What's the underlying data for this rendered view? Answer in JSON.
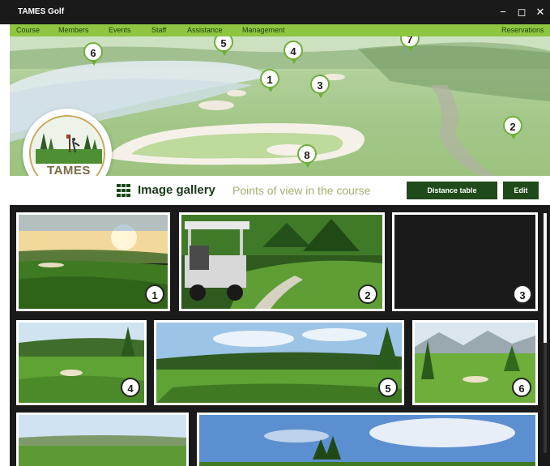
{
  "window": {
    "title": "TAMES Golf",
    "controls": {
      "minimize": "−",
      "maximize": "◻",
      "close": "✕"
    }
  },
  "menu": {
    "items": [
      "Course",
      "Members",
      "Events",
      "Staff",
      "Assistance",
      "Management"
    ],
    "right_item": "Reservations"
  },
  "hero": {
    "pins": [
      "1",
      "2",
      "3",
      "4",
      "5",
      "6",
      "7",
      "8"
    ]
  },
  "logo": {
    "name": "TAMES GOLF"
  },
  "toolbar": {
    "gallery_icon": "grid-icon",
    "gallery_label": "Image gallery",
    "pov_label": "Points of view in the course",
    "distance_button": "Distance table",
    "edit_button": "Edit"
  },
  "gallery": {
    "tiles": [
      "1",
      "2",
      "3",
      "4",
      "5",
      "6",
      "",
      ""
    ]
  },
  "colors": {
    "menu_green": "#8ec641",
    "button_green": "#1f4a1a",
    "title_bar": "#1a1a1a"
  }
}
